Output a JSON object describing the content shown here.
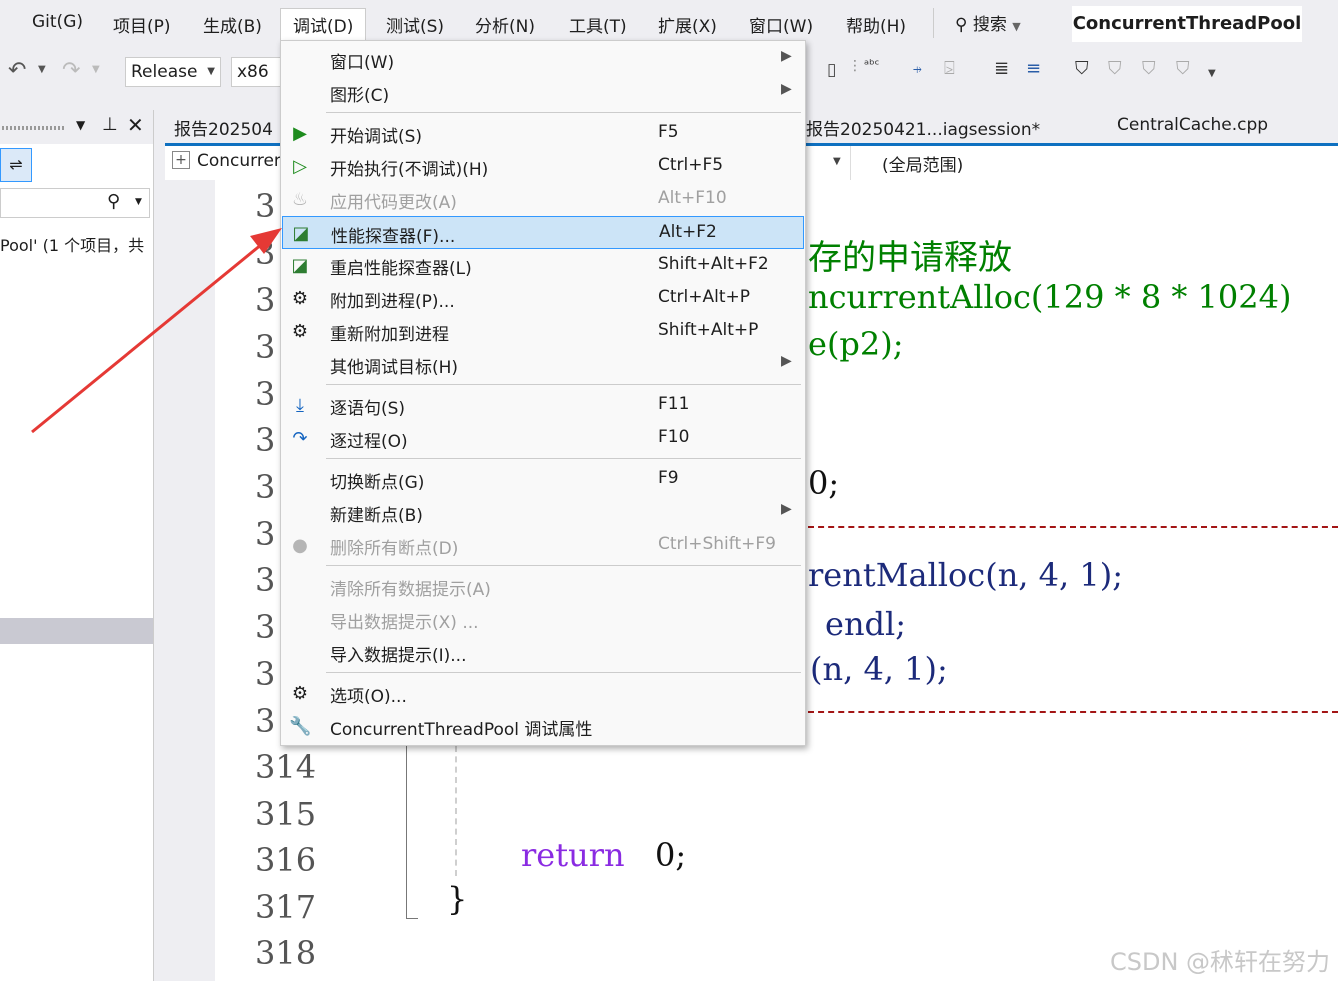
{
  "menubar": {
    "items": [
      "Git(G)",
      "项目(P)",
      "生成(B)",
      "调试(D)",
      "测试(S)",
      "分析(N)",
      "工具(T)",
      "扩展(X)",
      "窗口(W)",
      "帮助(H)"
    ],
    "search_label": "搜索",
    "project_title": "ConcurrentThreadPool"
  },
  "toolbar": {
    "config": "Release",
    "platform": "x86"
  },
  "left_panel": {
    "tree_text": "Pool' (1 个项目，共"
  },
  "tabs": {
    "tab1": "报告202504",
    "tab2": "报告20250421...iagsession*",
    "tab3": "CentralCache.cpp"
  },
  "navbar": {
    "project": "Concurren",
    "scope": "(全局范围)"
  },
  "editor": {
    "line_prefix": "3",
    "line_numbers": [
      "314",
      "315",
      "316",
      "317",
      "318"
    ],
    "code": {
      "comment": "存的申请释放",
      "alloc_call": "ncurrentAlloc(129 * 8 * 1024)",
      "free_call": "e(p2);",
      "zero_stmt": "0;",
      "malloc_call": "rentMalloc(n, 4, 1);",
      "endl_stmt": "endl;",
      "call3": "(n, 4, 1);",
      "return_kw": "return",
      "return_val": "0;",
      "close_brace": "}"
    }
  },
  "debug_menu": {
    "items": [
      {
        "label": "窗口(W)",
        "shortcut": "",
        "submenu": true,
        "disabled": false,
        "icon": ""
      },
      {
        "label": "图形(C)",
        "shortcut": "",
        "submenu": true,
        "disabled": false,
        "icon": ""
      },
      {
        "label": "开始调试(S)",
        "shortcut": "F5",
        "submenu": false,
        "disabled": false,
        "icon": "play-filled-icon"
      },
      {
        "label": "开始执行(不调试)(H)",
        "shortcut": "Ctrl+F5",
        "submenu": false,
        "disabled": false,
        "icon": "play-outline-icon"
      },
      {
        "label": "应用代码更改(A)",
        "shortcut": "Alt+F10",
        "submenu": false,
        "disabled": true,
        "icon": "flame-icon"
      },
      {
        "label": "性能探查器(F)...",
        "shortcut": "Alt+F2",
        "submenu": false,
        "disabled": false,
        "icon": "performance-chart-icon",
        "highlighted": true
      },
      {
        "label": "重启性能探查器(L)",
        "shortcut": "Shift+Alt+F2",
        "submenu": false,
        "disabled": false,
        "icon": "performance-chart-icon"
      },
      {
        "label": "附加到进程(P)...",
        "shortcut": "Ctrl+Alt+P",
        "submenu": false,
        "disabled": false,
        "icon": "gears-icon"
      },
      {
        "label": "重新附加到进程",
        "shortcut": "Shift+Alt+P",
        "submenu": false,
        "disabled": false,
        "icon": "gears-icon"
      },
      {
        "label": "其他调试目标(H)",
        "shortcut": "",
        "submenu": true,
        "disabled": false,
        "icon": ""
      },
      {
        "label": "逐语句(S)",
        "shortcut": "F11",
        "submenu": false,
        "disabled": false,
        "icon": "step-into-icon"
      },
      {
        "label": "逐过程(O)",
        "shortcut": "F10",
        "submenu": false,
        "disabled": false,
        "icon": "step-over-icon"
      },
      {
        "label": "切换断点(G)",
        "shortcut": "F9",
        "submenu": false,
        "disabled": false,
        "icon": ""
      },
      {
        "label": "新建断点(B)",
        "shortcut": "",
        "submenu": true,
        "disabled": false,
        "icon": ""
      },
      {
        "label": "删除所有断点(D)",
        "shortcut": "Ctrl+Shift+F9",
        "submenu": false,
        "disabled": true,
        "icon": "delete-breakpoints-icon"
      },
      {
        "label": "清除所有数据提示(A)",
        "shortcut": "",
        "submenu": false,
        "disabled": true,
        "icon": ""
      },
      {
        "label": "导出数据提示(X) ...",
        "shortcut": "",
        "submenu": false,
        "disabled": true,
        "icon": ""
      },
      {
        "label": "导入数据提示(I)...",
        "shortcut": "",
        "submenu": false,
        "disabled": false,
        "icon": ""
      },
      {
        "label": "选项(O)...",
        "shortcut": "",
        "submenu": false,
        "disabled": false,
        "icon": "gear-icon"
      },
      {
        "label": "ConcurrentThreadPool 调试属性",
        "shortcut": "",
        "submenu": false,
        "disabled": false,
        "icon": "wrench-icon"
      }
    ]
  },
  "watermark": "CSDN @秫轩在努力",
  "colors": {
    "accent": "#0e70c0",
    "highlight_bg": "#cce4f7",
    "highlight_border": "#3399ff",
    "annotation_arrow": "#e53935",
    "play_green": "#1e8c1e"
  }
}
